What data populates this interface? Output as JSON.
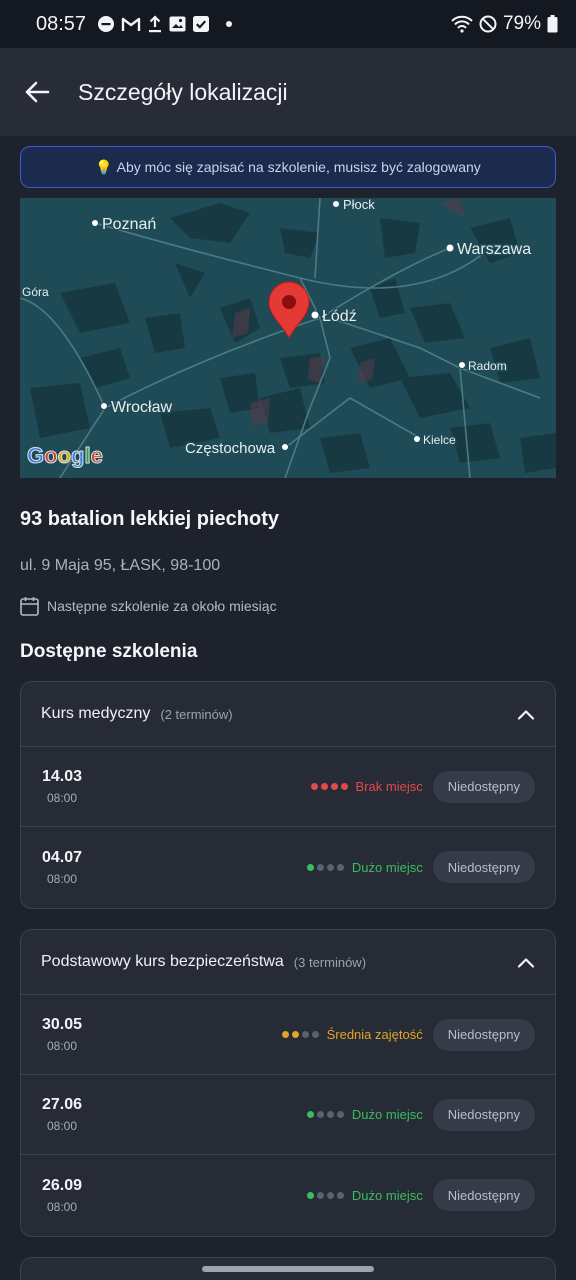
{
  "status_bar": {
    "time": "08:57",
    "battery": "79%",
    "notification_icons": [
      "do-not-disturb-icon",
      "gmail-icon",
      "upload-icon",
      "gallery-icon",
      "checkbox-icon",
      "dot-icon"
    ],
    "system_icons": [
      "wifi-icon",
      "block-icon",
      "battery-icon"
    ]
  },
  "app_bar": {
    "title": "Szczegóły lokalizacji"
  },
  "banner": {
    "icon": "💡",
    "text": "Aby móc się zapisać na szkolenie, musisz być zalogowany"
  },
  "map": {
    "cities": [
      "Płock",
      "Poznań",
      "Warszawa",
      "Góra",
      "Łódź",
      "Radom",
      "Wrocław",
      "Kielce",
      "Częstochowa"
    ],
    "logo": "Google"
  },
  "location": {
    "name": "93 batalion lekkiej piechoty",
    "address": "ul. 9 Maja 95, ŁASK, 98-100",
    "next_training": "Następne szkolenie za około miesiąc"
  },
  "section_title": "Dostępne szkolenia",
  "colors": {
    "full": "#e24a4a",
    "free": "#3bbd5c",
    "medium": "#e0a526",
    "dot_empty": "#5a6170"
  },
  "courses": [
    {
      "title": "Kurs medyczny",
      "count": "(2 terminów)",
      "sessions": [
        {
          "date": "14.03",
          "time": "08:00",
          "status": "Brak miejsc",
          "level": 4,
          "color": "#e24a4a",
          "button": "Niedostępny"
        },
        {
          "date": "04.07",
          "time": "08:00",
          "status": "Dużo miejsc",
          "level": 1,
          "color": "#3bbd5c",
          "button": "Niedostępny"
        }
      ]
    },
    {
      "title": "Podstawowy kurs bezpieczeństwa",
      "count": "(3 terminów)",
      "sessions": [
        {
          "date": "30.05",
          "time": "08:00",
          "status": "Średnia zajętość",
          "level": 2,
          "color": "#e0a526",
          "button": "Niedostępny"
        },
        {
          "date": "27.06",
          "time": "08:00",
          "status": "Dużo miejsc",
          "level": 1,
          "color": "#3bbd5c",
          "button": "Niedostępny"
        },
        {
          "date": "26.09",
          "time": "08:00",
          "status": "Dużo miejsc",
          "level": 1,
          "color": "#3bbd5c",
          "button": "Niedostępny"
        }
      ]
    }
  ]
}
